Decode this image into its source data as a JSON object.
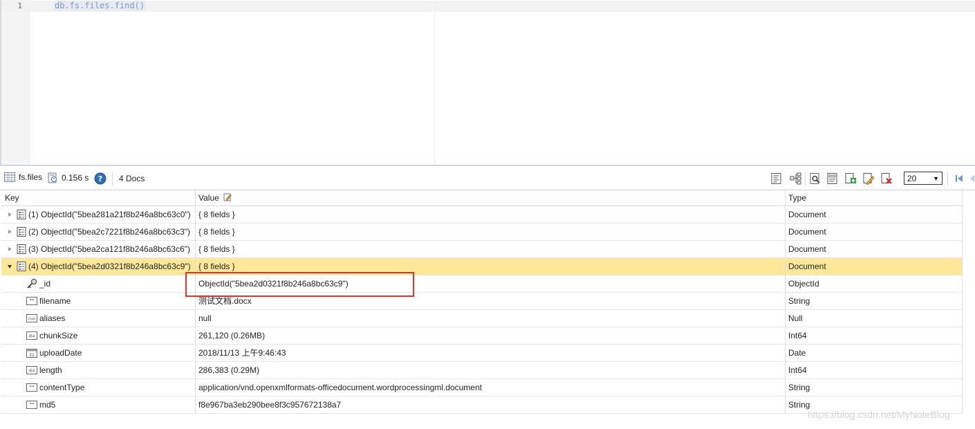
{
  "editor": {
    "line_number": "1",
    "code": "db.fs.files.find()"
  },
  "toolbar": {
    "collection": "fs.files",
    "elapsed": "0.156 s",
    "doc_count": "4 Docs",
    "page_size": "20",
    "icons": [
      "text-view-icon",
      "tree-view-icon",
      "find-icon",
      "view-document-icon",
      "insert-document-icon",
      "edit-document-icon",
      "delete-document-icon",
      "first-page-icon"
    ]
  },
  "grid": {
    "headers": {
      "key": "Key",
      "value": "Value",
      "type": "Type"
    },
    "documents": [
      {
        "key": "(1) ObjectId(\"5bea281a21f8b246a8bc63c0\")",
        "value": "{ 8 fields }",
        "type": "Document"
      },
      {
        "key": "(2) ObjectId(\"5bea2c7221f8b246a8bc63c3\")",
        "value": "{ 8 fields }",
        "type": "Document"
      },
      {
        "key": "(3) ObjectId(\"5bea2ca121f8b246a8bc63c6\")",
        "value": "{ 8 fields }",
        "type": "Document"
      },
      {
        "key": "(4) ObjectId(\"5bea2d0321f8b246a8bc63c9\")",
        "value": "{ 8 fields }",
        "type": "Document"
      }
    ],
    "fields": [
      {
        "key": "_id",
        "value": "ObjectId(\"5bea2d0321f8b246a8bc63c9\")",
        "type": "ObjectId",
        "icon": "key-icon"
      },
      {
        "key": "filename",
        "value": "测试文档.docx",
        "type": "String",
        "icon": "string-type-icon"
      },
      {
        "key": "aliases",
        "value": "null",
        "type": "Null",
        "icon": "null-type-icon"
      },
      {
        "key": "chunkSize",
        "value": "261,120 (0.26MB)",
        "type": "Int64",
        "icon": "int64-type-icon"
      },
      {
        "key": "uploadDate",
        "value": "2018/11/13 上午9:46:43",
        "type": "Date",
        "icon": "date-type-icon"
      },
      {
        "key": "length",
        "value": "286,383 (0.29M)",
        "type": "Int64",
        "icon": "int64-type-icon"
      },
      {
        "key": "contentType",
        "value": "application/vnd.openxmlformats-officedocument.wordprocessingml.document",
        "type": "String",
        "icon": "string-type-icon"
      },
      {
        "key": "md5",
        "value": "f8e967ba3eb290bee8f3c957672138a7",
        "type": "String",
        "icon": "string-type-icon"
      }
    ]
  },
  "watermark": "https://blog.csdn.net/MyNoteBlog",
  "colors": {
    "selected_row": "#fde89a",
    "highlight_box": "#e0332b",
    "code_text": "#7a9ac9"
  }
}
